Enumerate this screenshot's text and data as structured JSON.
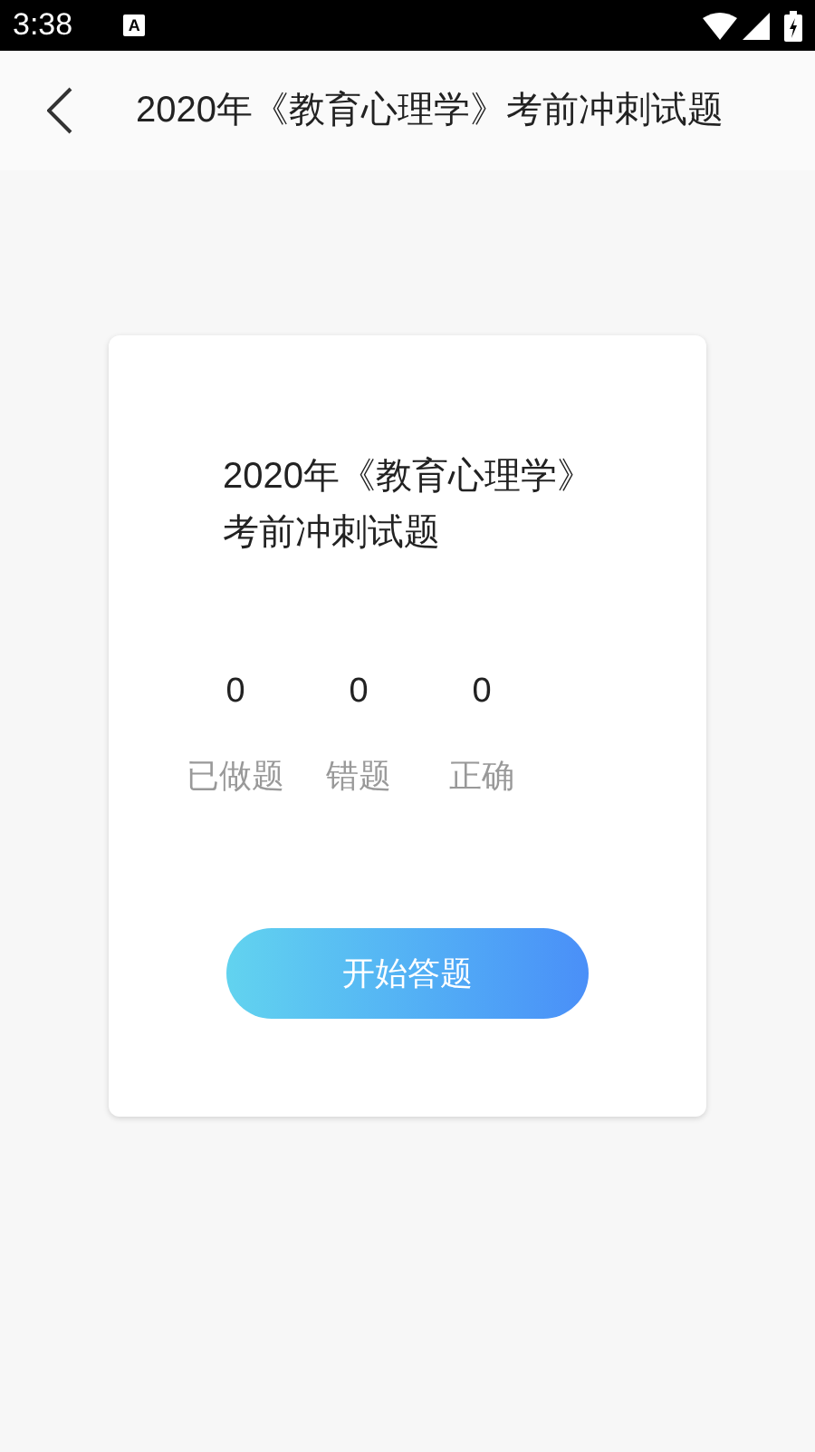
{
  "status_bar": {
    "time": "3:38",
    "notification_glyph": "A"
  },
  "header": {
    "title": "2020年《教育心理学》考前冲刺试题"
  },
  "card": {
    "title": "2020年《教育心理学》考前冲刺试题",
    "stats": [
      {
        "value": "0",
        "label": "已做题"
      },
      {
        "value": "0",
        "label": "错题"
      },
      {
        "value": "0",
        "label": "正确"
      }
    ],
    "button": "开始答题"
  }
}
